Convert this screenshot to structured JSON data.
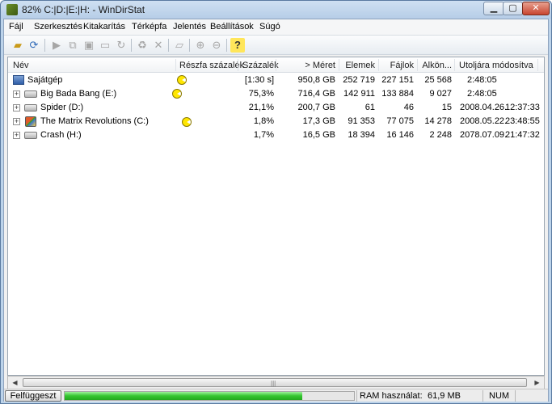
{
  "window": {
    "title": "82% C:|D:|E:|H: - WinDirStat"
  },
  "menu": [
    "Fájl",
    "Szerkesztés",
    "Kitakarítás",
    "Térképfa",
    "Jelentés",
    "Beállítások",
    "Súgó"
  ],
  "columns": {
    "name": "Név",
    "subtree_percent": "Részfa százalék",
    "percent": "Százalék",
    "size": "> Méret",
    "items": "Elemek",
    "files": "Fájlok",
    "subdirs": "Alkön...",
    "last_modified": "Utoljára módosítva"
  },
  "rows": [
    {
      "name": "Sajátgép",
      "percent": "[1:30 s]",
      "size": "950,8 GB",
      "items": "252 719",
      "files": "227 151",
      "subdirs": "25 568",
      "date": "",
      "time": "2:48:05",
      "subtree_fraction": 1.0
    },
    {
      "name": "Big Bada Bang (E:)",
      "percent": "75,3%",
      "size": "716,4 GB",
      "items": "142 911",
      "files": "133 884",
      "subdirs": "9 027",
      "date": "",
      "time": "2:48:05",
      "subtree_fraction": 0.753
    },
    {
      "name": "Spider (D:)",
      "percent": "21,1%",
      "size": "200,7 GB",
      "items": "61",
      "files": "46",
      "subdirs": "15",
      "date": "2008.04.26.",
      "time": "12:37:33",
      "subtree_fraction": 0.211
    },
    {
      "name": "The Matrix Revolutions (C:)",
      "percent": "1,8%",
      "size": "17,3 GB",
      "items": "91 353",
      "files": "77 075",
      "subdirs": "14 278",
      "date": "2008.05.22.",
      "time": "23:48:55",
      "subtree_fraction": 0.018
    },
    {
      "name": "Crash (H:)",
      "percent": "1,7%",
      "size": "16,5 GB",
      "items": "18 394",
      "files": "16 146",
      "subdirs": "2 248",
      "date": "2078.07.09.",
      "time": "21:47:32",
      "subtree_fraction": 0.017
    }
  ],
  "status": {
    "pause_label": "Felfüggeszt",
    "ram_label": "RAM használat:",
    "ram_value": "61,9 MB",
    "num": "NUM",
    "progress_fraction": 0.82
  }
}
